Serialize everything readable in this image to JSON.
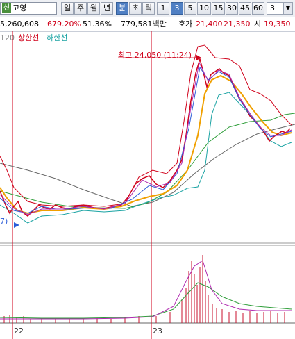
{
  "toolbar": {
    "stock_badge": "신",
    "stock_name": "고영",
    "periods": [
      "일",
      "주",
      "월",
      "년",
      "분",
      "초",
      "틱"
    ],
    "active_period": "분",
    "intervals": [
      "1",
      "3",
      "5",
      "10",
      "15",
      "30",
      "45",
      "60"
    ],
    "active_interval": "3",
    "interval_select": "3",
    "dropdown_arrow": "▼"
  },
  "info": {
    "volume": "5,260,608",
    "change_pct": "679.20%",
    "ratio": "51.36%",
    "amount": "779,581백만",
    "quote_label": "호가",
    "ask": "21,400",
    "bid": "21,350",
    "open_label": "시",
    "open_price": "19,350"
  },
  "legend": {
    "period": "120",
    "upper_limit": "상한선",
    "lower_limit": "하한선"
  },
  "annotation": {
    "high_label": "최고 24,050 (11:24)",
    "low_fragment": "7)"
  },
  "x_axis": {
    "day1": "22",
    "day2": "23"
  },
  "colors": {
    "price_line": "#d0021b",
    "ma_orange": "#f0a000",
    "ma_teal": "#1aa3a3",
    "ma_green": "#2f9e3a",
    "ma_gray": "#666666",
    "volume_bars": "#c8102e"
  }
}
